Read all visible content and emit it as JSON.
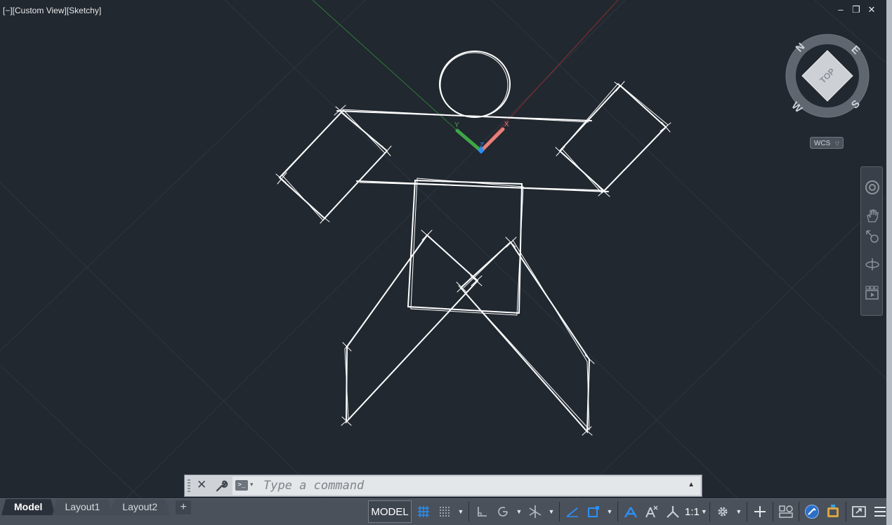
{
  "viewport": {
    "label": "[−][Custom View][Sketchy]",
    "window_controls": [
      "–",
      "❐",
      "✕"
    ]
  },
  "viewcube": {
    "top_face": "TOP",
    "compass": {
      "north": "N",
      "east": "E",
      "south": "S",
      "west": "W"
    },
    "wcs_label": "WCS"
  },
  "ucs_icon": {
    "x_label": "X",
    "y_label": "Y",
    "z_label": "Z"
  },
  "command_line": {
    "placeholder": "Type a command"
  },
  "layout_tabs": [
    {
      "label": "Model",
      "active": true
    },
    {
      "label": "Layout1",
      "active": false
    },
    {
      "label": "Layout2",
      "active": false
    }
  ],
  "add_tab_label": "+",
  "status_bar": {
    "space_label": "MODEL",
    "annotation_scale": "1:1"
  },
  "colors": {
    "viewport_bg": "#212830",
    "sketch_lines": "#ffffff",
    "accent_blue": "#2d8ef0",
    "x_axis": "#e8807a",
    "y_axis": "#3fa648"
  }
}
